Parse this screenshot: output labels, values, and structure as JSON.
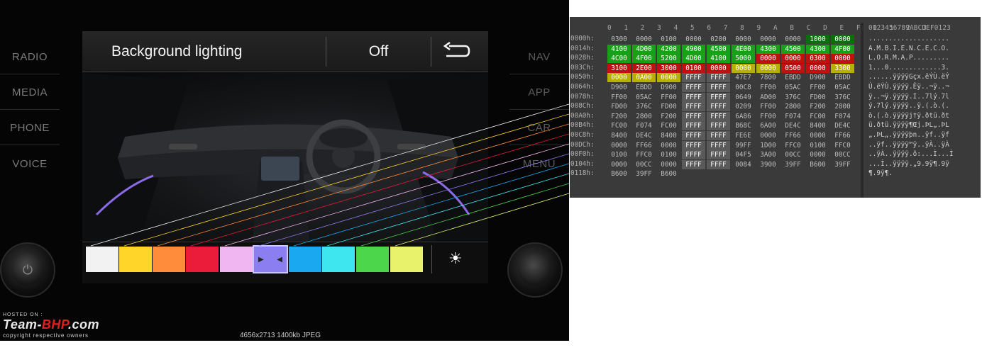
{
  "side_left": [
    "RADIO",
    "MEDIA",
    "PHONE",
    "VOICE"
  ],
  "side_right": [
    "NAV",
    "APP",
    "CAR",
    "MENU"
  ],
  "topbar": {
    "title": "Background lighting",
    "state": "Off",
    "back_icon": "return-arrow-icon"
  },
  "colors": [
    {
      "hex": "#f2f2f2"
    },
    {
      "hex": "#ffd52a"
    },
    {
      "hex": "#ff8c3a"
    },
    {
      "hex": "#ea1c3a"
    },
    {
      "hex": "#f0b6f2"
    },
    {
      "hex": "#8a7ef0",
      "selected": true
    },
    {
      "hex": "#1aa9f0"
    },
    {
      "hex": "#3ee6f0"
    },
    {
      "hex": "#4bd64b"
    },
    {
      "hex": "#e8f26a"
    }
  ],
  "brightness_icon": "sun-icon",
  "watermark": {
    "hosted": "HOSTED ON :",
    "brand_a": "Team-",
    "brand_b": "BHP",
    "brand_c": ".com",
    "copy": "copyright respective owners"
  },
  "image_info": "4656x2713 1400kb JPEG",
  "hex": {
    "col_header": "0 1 2 3 4 5 6 7 8 9 A B C D E F 0 1 2 3",
    "ascii_header": "0123456789ABCDEF0123",
    "rows": [
      {
        "off": "0000h:",
        "cells": [
          "0300",
          "0000",
          "0100",
          "0000",
          "0200",
          "0000",
          "0000",
          "0000",
          "1000",
          "0000"
        ],
        "ascii": "...................."
      },
      {
        "off": "0014h:",
        "cells": [
          "4100",
          "4D00",
          "4200",
          "4900",
          "4500",
          "4E00",
          "4300",
          "4500",
          "4300",
          "4F00"
        ],
        "ascii": "A.M.B.I.E.N.C.E.C.O."
      },
      {
        "off": "0028h:",
        "cells": [
          "4C00",
          "4F00",
          "5200",
          "4D00",
          "4100",
          "5000",
          "0000",
          "0000",
          "0300",
          "0000"
        ],
        "ascii": "L.O.R.M.A.P........."
      },
      {
        "off": "003Ch:",
        "cells": [
          "3100",
          "2E00",
          "3000",
          "0100",
          "0000",
          "0000",
          "0000",
          "0500",
          "0000",
          "3300"
        ],
        "ascii": "1...0.............3."
      },
      {
        "off": "0050h:",
        "cells": [
          "0000",
          "0A00",
          "0000",
          "FFFF",
          "FFFF",
          "47E7",
          "7800",
          "EBDD",
          "D900",
          "EBDD"
        ],
        "ascii": "......ÿÿÿÿGçx.ëÝÙ.ëÝ"
      },
      {
        "off": "0064h:",
        "cells": [
          "D900",
          "EBDD",
          "D900",
          "FFFF",
          "FFFF",
          "00C8",
          "FF00",
          "05AC",
          "FF00",
          "05AC"
        ],
        "ascii": "Ù.ëÝÙ.ÿÿÿÿ.Èÿ..¬ÿ..¬"
      },
      {
        "off": "0078h:",
        "cells": [
          "FF00",
          "05AC",
          "FF00",
          "FFFF",
          "FFFF",
          "0649",
          "AD00",
          "376C",
          "FD00",
          "376C"
        ],
        "ascii": "ÿ..¬ÿ.ÿÿÿÿ.I..7lý.7l"
      },
      {
        "off": "008Ch:",
        "cells": [
          "FD00",
          "376C",
          "FD00",
          "FFFF",
          "FFFF",
          "0209",
          "FF00",
          "2800",
          "F200",
          "2800"
        ],
        "ascii": "ý.7lý.ÿÿÿÿ..ÿ.(.ò.(."
      },
      {
        "off": "00A0h:",
        "cells": [
          "F200",
          "2800",
          "F200",
          "FFFF",
          "FFFF",
          "6A86",
          "FF00",
          "F074",
          "FC00",
          "F074"
        ],
        "ascii": "ò.(.ò.ÿÿÿÿj†ÿ.ðtü.ðt"
      },
      {
        "off": "00B4h:",
        "cells": [
          "FC00",
          "F074",
          "FC00",
          "FFFF",
          "FFFF",
          "B68C",
          "6A00",
          "DE4C",
          "8400",
          "DE4C"
        ],
        "ascii": "ü.ðtü.ÿÿÿÿ¶Œj.ÞL„.ÞL"
      },
      {
        "off": "00C8h:",
        "cells": [
          "8400",
          "DE4C",
          "8400",
          "FFFF",
          "FFFF",
          "FE6E",
          "0000",
          "FF66",
          "0000",
          "FF66"
        ],
        "ascii": "„.ÞL„.ÿÿÿÿþn..ÿf..ÿf"
      },
      {
        "off": "00DCh:",
        "cells": [
          "0000",
          "FF66",
          "0000",
          "FFFF",
          "FFFF",
          "99FF",
          "1D00",
          "FFC0",
          "0100",
          "FFC0"
        ],
        "ascii": "..ÿf..ÿÿÿÿ™ÿ..ÿÀ..ÿÀ"
      },
      {
        "off": "00F0h:",
        "cells": [
          "0100",
          "FFC0",
          "0100",
          "FFFF",
          "FFFF",
          "04F5",
          "3A00",
          "00CC",
          "0000",
          "00CC"
        ],
        "ascii": "..ÿÀ..ÿÿÿÿ.õ:...Ì...Ì"
      },
      {
        "off": "0104h:",
        "cells": [
          "0000",
          "00CC",
          "0000",
          "FFFF",
          "FFFF",
          "0084",
          "3900",
          "39FF",
          "B600",
          "39FF"
        ],
        "ascii": "...Ì..ÿÿÿÿ.„9.9ÿ¶.9ÿ"
      },
      {
        "off": "0118h:",
        "cells": [
          "B600",
          "39FF",
          "B600"
        ],
        "ascii": "¶.9ÿ¶."
      }
    ]
  }
}
